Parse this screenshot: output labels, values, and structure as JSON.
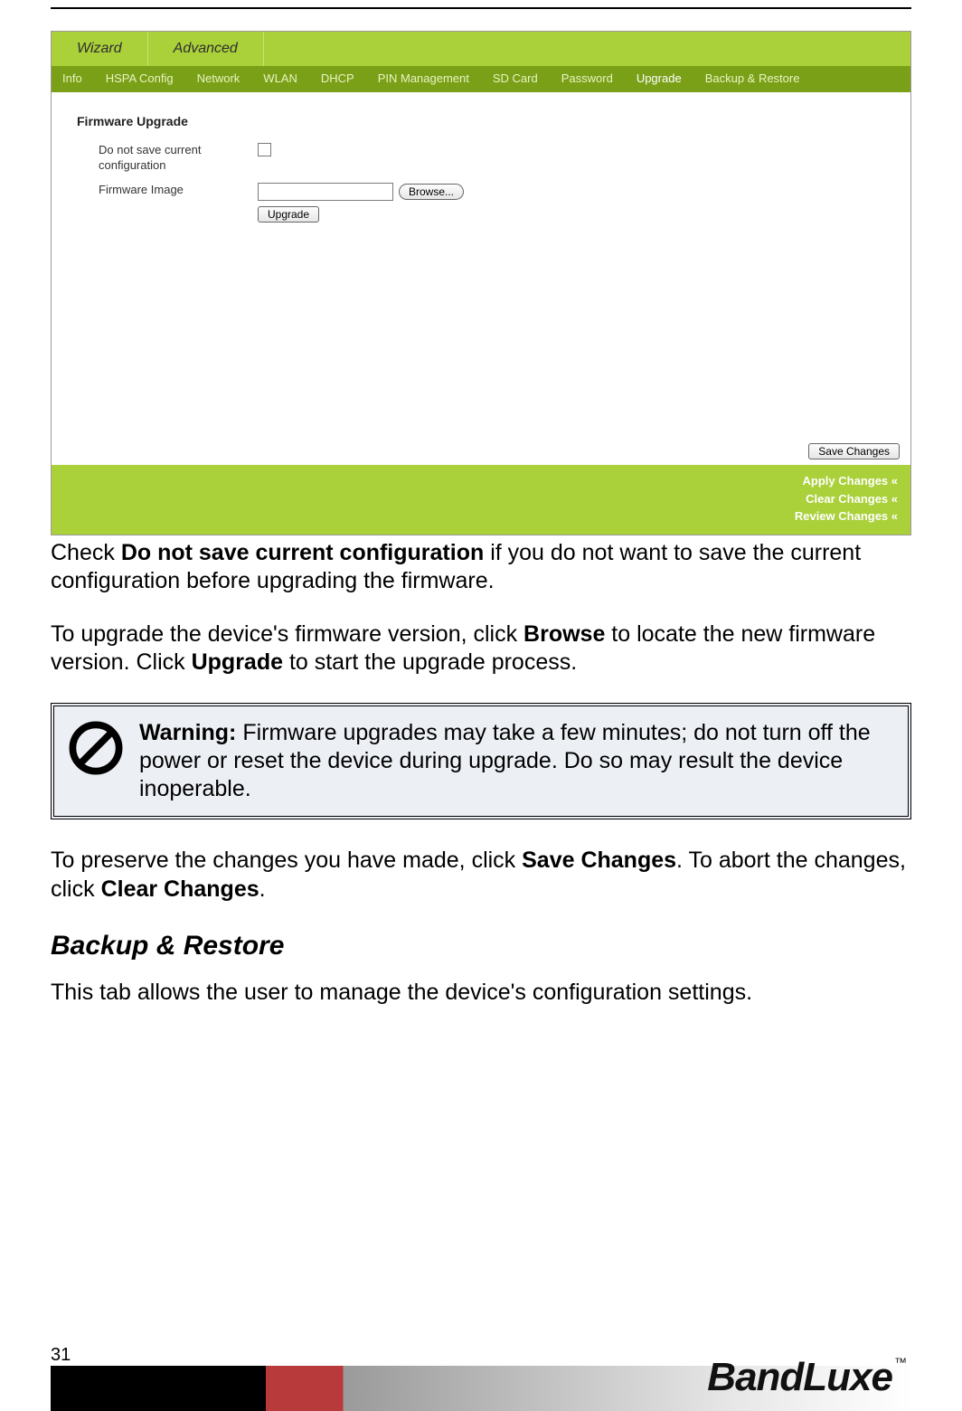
{
  "page_number": "31",
  "brand": "BandLuxe",
  "brand_tm": "™",
  "ui": {
    "main_tabs": [
      "Wizard",
      "Advanced"
    ],
    "sub_tabs": [
      "Info",
      "HSPA Config",
      "Network",
      "WLAN",
      "DHCP",
      "PIN Management",
      "SD Card",
      "Password",
      "Upgrade",
      "Backup & Restore"
    ],
    "active_sub_tab_index": 8,
    "section_title": "Firmware Upgrade",
    "row1_label": "Do not save current configuration",
    "row2_label": "Firmware Image",
    "browse_label": "Browse...",
    "upgrade_label": "Upgrade",
    "save_changes_label": "Save Changes",
    "footer_links": [
      "Apply Changes «",
      "Clear Changes «",
      "Review Changes «"
    ]
  },
  "article": {
    "p1_a": "Check ",
    "p1_b": "Do not save current configuration",
    "p1_c": " if you do not want to save the current configuration before upgrading the firmware.",
    "p2_a": "To upgrade the device's firmware version, click ",
    "p2_b": "Browse",
    "p2_c": " to locate the new firmware version. Click ",
    "p2_d": "Upgrade",
    "p2_e": " to start the upgrade process.",
    "warn_b": "Warning:",
    "warn_t": " Firmware upgrades may take a few minutes; do not turn off the power or reset the device during upgrade. Do so may result the device inoperable.",
    "p3_a": "To preserve the changes you have made, click ",
    "p3_b": "Save Changes",
    "p3_c": ". To abort the changes, click ",
    "p3_d": "Clear Changes",
    "p3_e": ".",
    "heading": "Backup & Restore",
    "p4": "This tab allows the user to manage the device's configuration settings."
  }
}
